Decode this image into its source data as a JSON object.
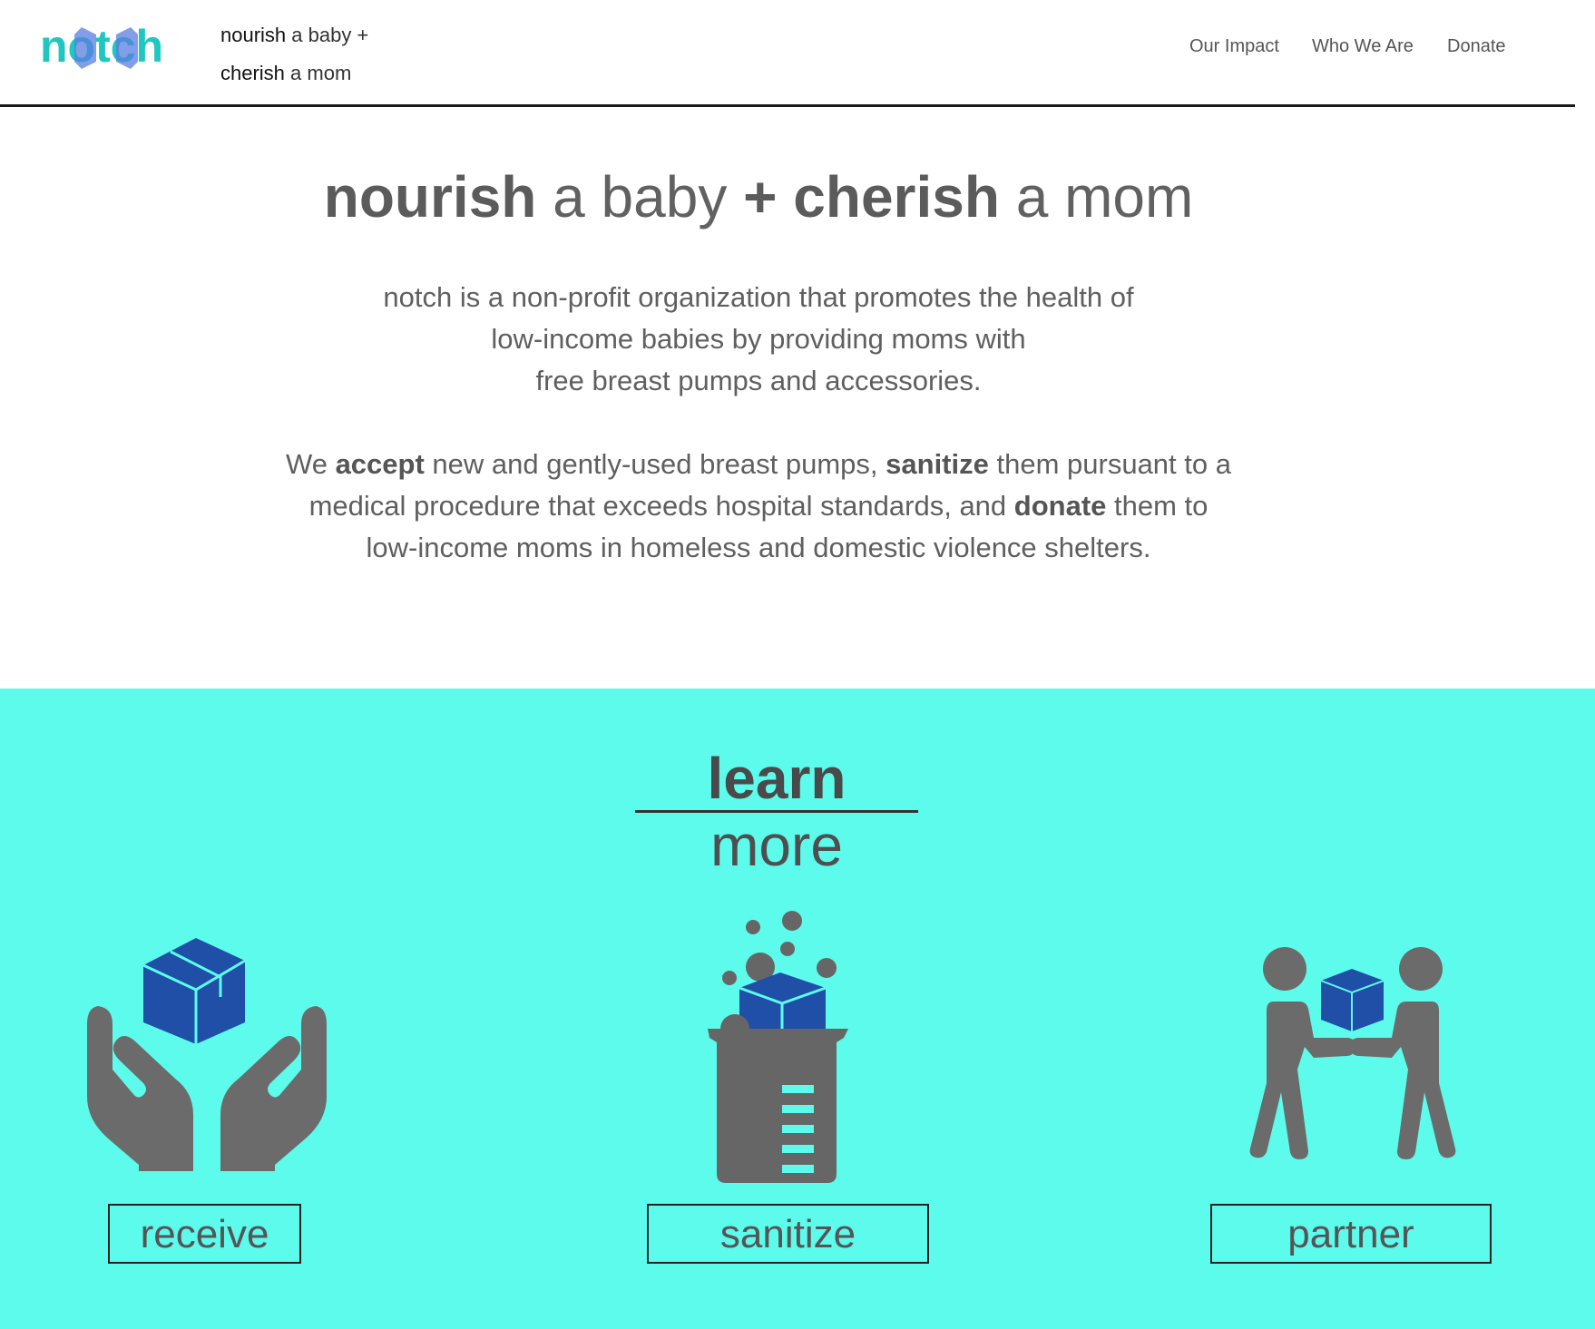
{
  "brand": {
    "logo_text": "notch",
    "accent": "#1ec8c0",
    "logo_mid": "#5a7de0"
  },
  "header": {
    "tagline_1_strong": "nourish",
    "tagline_1_rest": " a baby +",
    "tagline_2_strong": "cherish",
    "tagline_2_rest": " a mom"
  },
  "nav": {
    "items": [
      "Our Impact",
      "Who We Are",
      "Donate"
    ]
  },
  "hero": {
    "title_1": "nourish",
    "title_2": " a baby ",
    "title_plus": "+",
    "title_3": " cherish",
    "title_4": " a mom",
    "p1_line1": "notch is a non-profit organization that promotes the health of",
    "p1_line2": "low-income babies by providing moms with",
    "p1_line3": "free breast pumps and accessories.",
    "p2_a": "We ",
    "p2_accept": "accept",
    "p2_b": " new and gently-used breast pumps, ",
    "p2_sanitize": "sanitize",
    "p2_c": " them pursuant to a",
    "p2_d": "medical procedure that exceeds hospital standards, and ",
    "p2_donate": "donate",
    "p2_e": " them to",
    "p2_f": "low-income moms in homeless and domestic violence shelters."
  },
  "learn_more": {
    "title_strong": "learn",
    "title_rest": " more",
    "background": "#5cfbec",
    "cards": [
      {
        "icon": "hands-receive-box-icon",
        "label": "receive"
      },
      {
        "icon": "beaker-sanitize-box-icon",
        "label": "sanitize"
      },
      {
        "icon": "people-handoff-box-icon",
        "label": "partner"
      }
    ]
  }
}
